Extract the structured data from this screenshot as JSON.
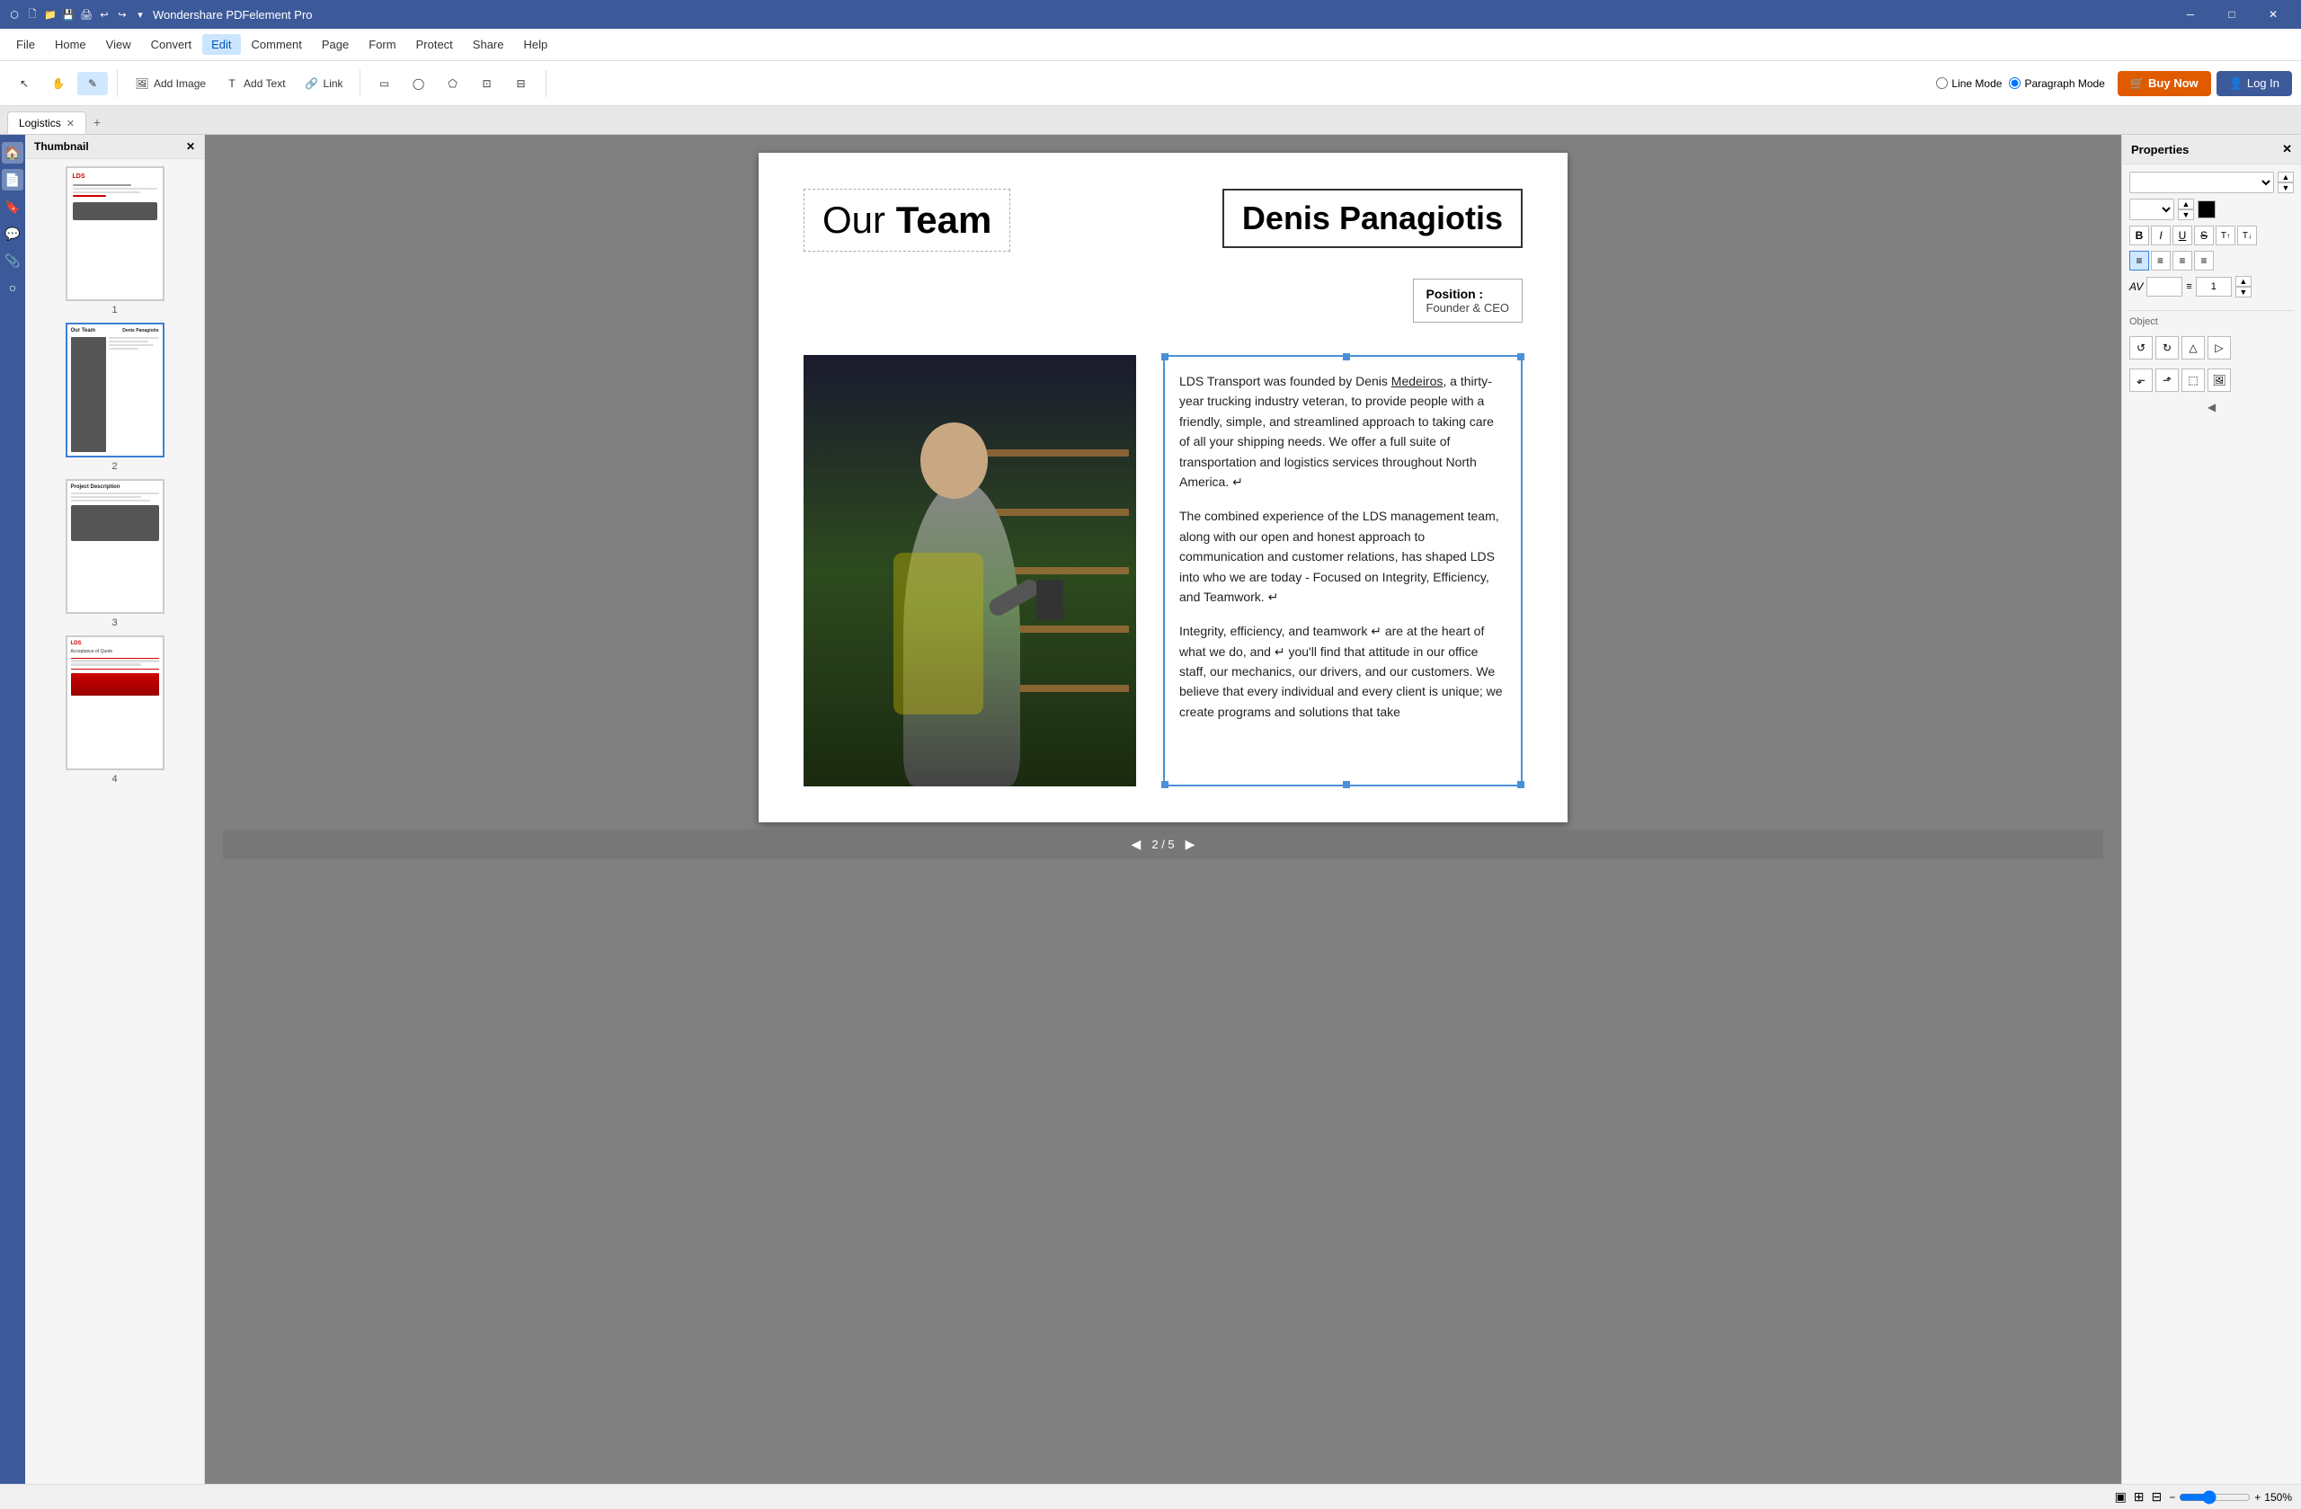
{
  "app": {
    "title": "Wondershare PDFelement Pro",
    "window_controls": [
      "minimize",
      "maximize",
      "close"
    ]
  },
  "title_bar": {
    "icons": [
      "file",
      "folder-open",
      "save",
      "print",
      "undo",
      "redo",
      "arrow-down"
    ],
    "title": "Wondershare PDFelement Pro"
  },
  "menu": {
    "items": [
      "File",
      "Home",
      "View",
      "Convert",
      "Edit",
      "Comment",
      "Page",
      "Form",
      "Protect",
      "Share",
      "Help"
    ],
    "active": "Edit"
  },
  "toolbar": {
    "groups": [
      {
        "name": "selection-tools",
        "buttons": [
          {
            "id": "select",
            "label": "",
            "icon": "cursor"
          },
          {
            "id": "hand",
            "label": "",
            "icon": "hand"
          },
          {
            "id": "edit-text",
            "label": "",
            "icon": "pencil"
          }
        ]
      },
      {
        "name": "insert-tools",
        "buttons": [
          {
            "id": "add-image",
            "label": "Add Image",
            "icon": "image"
          },
          {
            "id": "add-text",
            "label": "Add Text",
            "icon": "text"
          },
          {
            "id": "link",
            "label": "Link",
            "icon": "link"
          }
        ]
      },
      {
        "name": "shape-tools",
        "buttons": [
          {
            "id": "rect",
            "label": "",
            "icon": "rectangle"
          },
          {
            "id": "ellipse",
            "label": "",
            "icon": "ellipse"
          },
          {
            "id": "poly",
            "label": "",
            "icon": "polygon"
          },
          {
            "id": "header",
            "label": "",
            "icon": "header"
          },
          {
            "id": "footer",
            "label": "",
            "icon": "footer"
          }
        ]
      }
    ],
    "mode": {
      "line_mode": {
        "label": "Line Mode",
        "selected": false
      },
      "paragraph_mode": {
        "label": "Paragraph Mode",
        "selected": true
      }
    },
    "buy_now": "Buy Now",
    "log_in": "Log In"
  },
  "tabs": {
    "items": [
      {
        "label": "Logistics",
        "active": true
      }
    ],
    "add_label": "+"
  },
  "thumbnails": {
    "header": "Thumbnail",
    "pages": [
      {
        "number": "1",
        "active": false
      },
      {
        "number": "2",
        "active": true
      },
      {
        "number": "3",
        "active": false
      },
      {
        "number": "4",
        "active": false
      }
    ]
  },
  "pdf_page": {
    "our_team": "Our Team",
    "name": "Denis Panagiotis",
    "position_label": "Position",
    "position_separator": ":",
    "position_value": "Founder & CEO",
    "paragraphs": [
      "LDS Transport was founded by Denis Medeiros, a thirty-year trucking industry veteran, to provide people with a friendly, simple, and streamlined approach to taking care of all your shipping needs. We offer a full suite of transportation and logistics services throughout North America. ↵",
      "The combined experience of the LDS management team, along with our open and honest approach to communication and customer relations, has shaped LDS into who we are today - Focused on Integrity, Efficiency, and Teamwork. ↵",
      "Integrity, efficiency, and teamwork ↵ are at the heart of what we do, and ↵ you'll find that attitude in our office staff, our mechanics, our drivers, and our customers. We believe that every individual and every client is unique; we create programs and solutions that take"
    ],
    "page_indicator": "2 / 5"
  },
  "navigation": {
    "prev": "◀",
    "next": "▶",
    "current_page": "2",
    "total_pages": "5",
    "separator": "/"
  },
  "properties": {
    "header": "Properties",
    "font_name": "",
    "font_size": "",
    "text_color": "#000000",
    "styles": {
      "bold": "B",
      "italic": "I",
      "underline": "U",
      "strikethrough": "S"
    },
    "superscript": "T↑",
    "subscript": "T↓",
    "alignment": {
      "left": "left",
      "center": "center",
      "right": "right",
      "justify": "justify",
      "active": "left"
    },
    "spacing_label": "AV",
    "line_spacing_label": "≡",
    "line_spacing_value": "1",
    "object_section": "Object",
    "object_tools": [
      "rotate-ccw",
      "rotate-cw",
      "flip-v",
      "flip-h",
      "align-left-obj",
      "align-right-obj",
      "crop",
      "image"
    ]
  },
  "status_bar": {
    "view_icons": [
      "grid-single",
      "grid-double",
      "grid-multi"
    ],
    "zoom_level": "150%"
  }
}
